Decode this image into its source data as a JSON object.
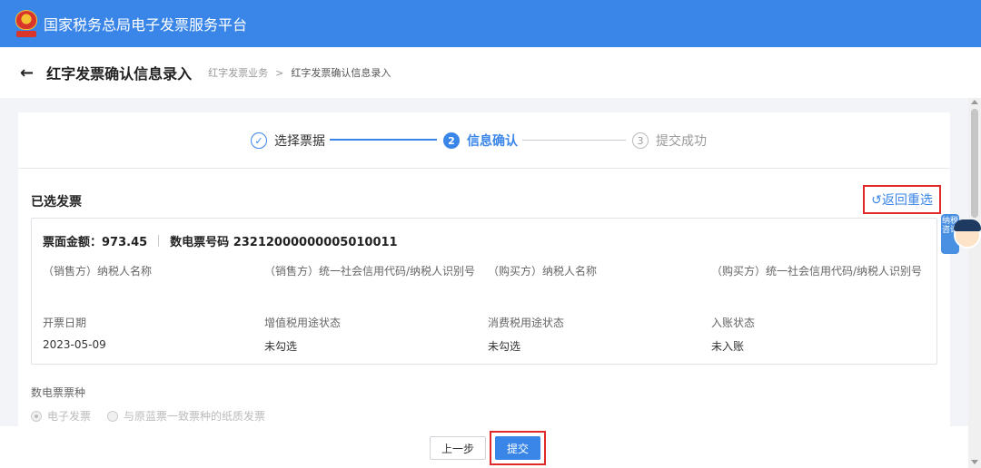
{
  "header": {
    "app_title": "国家税务总局电子发票服务平台"
  },
  "subheader": {
    "page_title": "红字发票确认信息录入",
    "breadcrumbs": [
      "红字发票业务",
      "红字发票确认信息录入"
    ],
    "breadcrumb_separator": ">"
  },
  "steps": [
    {
      "number": "✓",
      "label": "选择票据",
      "state": "done"
    },
    {
      "number": "2",
      "label": "信息确认",
      "state": "active"
    },
    {
      "number": "3",
      "label": "提交成功",
      "state": "pending"
    }
  ],
  "selected_section": {
    "title": "已选发票",
    "reselect_label": "↺返回重选"
  },
  "invoice": {
    "amount_text": "票面金额：973.45",
    "number_text": "数电票号码 23212000000005010011",
    "fields": [
      {
        "label": "（销售方）纳税人名称",
        "value": ""
      },
      {
        "label": "（销售方）统一社会信用代码/纳税人识别号",
        "value": ""
      },
      {
        "label": "（购买方）纳税人名称",
        "value": ""
      },
      {
        "label": "（购买方）统一社会信用代码/纳税人识别号",
        "value": ""
      },
      {
        "label": "开票日期",
        "value": "2023-05-09"
      },
      {
        "label": "增值税用途状态",
        "value": "未勾选"
      },
      {
        "label": "消费税用途状态",
        "value": "未勾选"
      },
      {
        "label": "入账状态",
        "value": "未入账"
      }
    ]
  },
  "invoice_kind": {
    "title": "数电票票种",
    "options": [
      {
        "label": "电子发票",
        "selected": true
      },
      {
        "label": "与原蓝票一致票种的纸质发票",
        "selected": false
      }
    ]
  },
  "footer": {
    "prev_label": "上一步",
    "submit_label": "提交"
  },
  "assistant": {
    "badge_text": "纳税咨询"
  },
  "colors": {
    "primary": "#3a86e8",
    "highlight_border": "#e02a2a"
  }
}
